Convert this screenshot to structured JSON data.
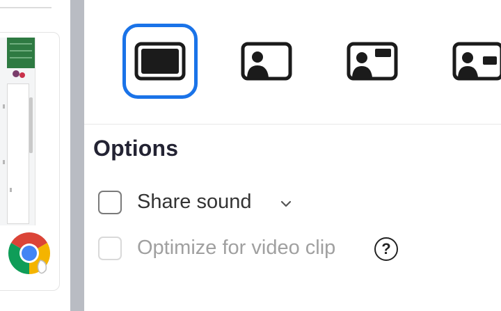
{
  "layout_options": [
    {
      "icon": "fullscreen-share-icon",
      "selected": true
    },
    {
      "icon": "presenter-background-icon",
      "selected": false
    },
    {
      "icon": "presenter-background-inset-icon",
      "selected": false
    },
    {
      "icon": "presenter-side-icon",
      "selected": false
    }
  ],
  "options": {
    "title": "Options",
    "share_sound": {
      "label": "Share sound",
      "checked": false,
      "enabled": true
    },
    "optimize_video": {
      "label": "Optimize for video clip",
      "checked": false,
      "enabled": false
    },
    "help_glyph": "?"
  },
  "left_panel": {
    "browser_icon": "chrome-icon"
  },
  "colors": {
    "selection_accent": "#1a73e8",
    "text_primary": "#232333",
    "text_disabled": "#a0a0a0"
  }
}
